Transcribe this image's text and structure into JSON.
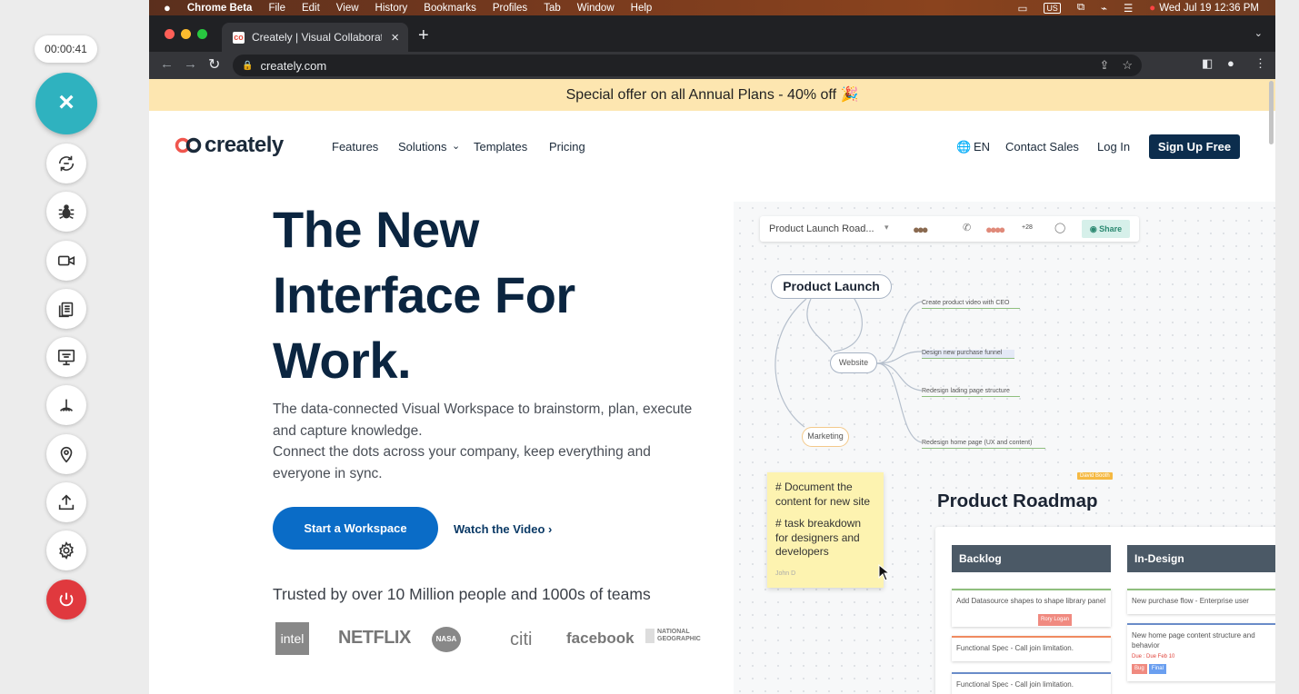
{
  "recorder": {
    "timer": "00:00:41",
    "close_icon": "×",
    "tools": [
      "restart-icon",
      "bug-icon",
      "camera-icon",
      "copy-icon",
      "screen-share-icon",
      "signal-icon",
      "location-pin-icon",
      "upload-icon",
      "gear-icon"
    ],
    "power_icon": "power-icon",
    "accent": "#2fb2bf",
    "power_color": "#e0393e"
  },
  "menubar": {
    "app": "Chrome Beta",
    "items": [
      "File",
      "Edit",
      "View",
      "History",
      "Bookmarks",
      "Profiles",
      "Tab",
      "Window",
      "Help"
    ],
    "input_source": "US",
    "clock": "Wed Jul 19  12:36 PM"
  },
  "browser": {
    "tab_title": "Creately | Visual Collaboration",
    "tab_close": "×",
    "new_tab": "+",
    "url": "creately.com"
  },
  "site": {
    "promo": "Special offer on all Annual Plans - 40% off 🎉",
    "brand": "creately",
    "nav": {
      "features": "Features",
      "solutions": "Solutions",
      "templates": "Templates",
      "pricing": "Pricing"
    },
    "lang": "EN",
    "contact": "Contact Sales",
    "login": "Log In",
    "signup": "Sign Up Free",
    "hero_lines": [
      "The New",
      "Interface For",
      "Work."
    ],
    "sub_1": "The data-connected Visual Workspace to brainstorm, plan, execute and capture knowledge.",
    "sub_2": "Connect the dots across your company, keep everything and everyone in sync.",
    "cta": "Start a Workspace",
    "watch": "Watch the Video ›",
    "trust": "Trusted by over 10 Million people and 1000s of teams",
    "logos": [
      "intel",
      "NETFLIX",
      "NASA",
      "citi",
      "facebook",
      "NATIONAL GEOGRAPHIC"
    ]
  },
  "canvas": {
    "doc_title": "Product Launch Road...",
    "collab_count": "+28",
    "share": "Share",
    "root": "Product Launch",
    "website": "Website",
    "marketing": "Marketing",
    "leaves": [
      "Create product video with CEO",
      "Design new purchase funnel",
      "Redesign lading page structure",
      "Redesign home page (UX and content)"
    ],
    "user_tag": "David Booth",
    "sticky_1": "# Document the content for new site",
    "sticky_2": "# task breakdown for designers and developers",
    "sticky_author": "John D",
    "roadmap_title": "Product Roadmap",
    "columns": [
      {
        "name": "Backlog",
        "cards": [
          "Add Datasource shapes to shape library panel",
          "Functional Spec - Call join limitation.",
          "Functional Spec - Call join limitation."
        ]
      },
      {
        "name": "In-Design",
        "cards": [
          "New purchase flow - Enterprise user",
          "New home page content structure and behavior"
        ]
      }
    ],
    "card_tag": "Rory Logan",
    "due": "Due : Due Feb 10",
    "tags": [
      "Bug",
      "Final"
    ]
  }
}
